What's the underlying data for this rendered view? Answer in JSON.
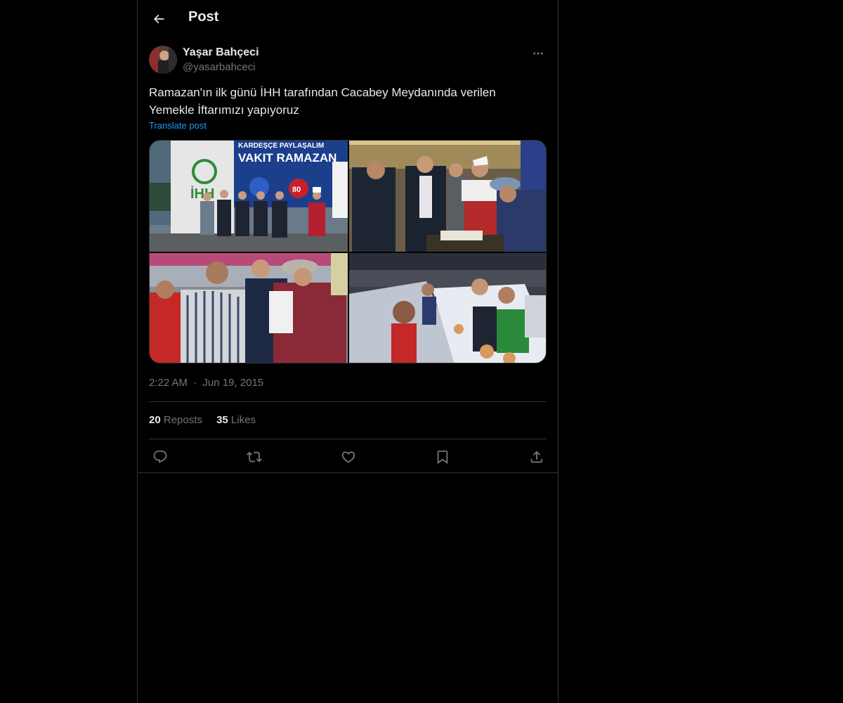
{
  "header": {
    "title": "Post"
  },
  "post": {
    "author": {
      "display_name": "Yaşar Bahçeci",
      "handle": "@yasarbahceci"
    },
    "text": "Ramazan'ın ilk günü İHH tarafından Cacabey Meydanında verilen\nYemekle İftarımızı yapıyoruz",
    "translate_label": "Translate post",
    "time": "2:22 AM",
    "separator": "·",
    "date": "Jun 19, 2015",
    "reposts_count": "20",
    "reposts_label": "Reposts",
    "likes_count": "35",
    "likes_label": "Likes"
  },
  "media": {
    "tile1_sign_top": "KARDEŞÇE PAYLAŞALIM",
    "tile1_sign_main": "VAKIT RAMAZAN",
    "tile1_logo": "İHH",
    "tile1_badge": "80"
  },
  "icons": {
    "back": "arrow-left-icon",
    "more": "more-horizontal-icon",
    "reply": "reply-icon",
    "repost": "repost-icon",
    "like": "heart-icon",
    "bookmark": "bookmark-icon",
    "share": "share-icon"
  },
  "colors": {
    "background": "#000000",
    "text_primary": "#e7e9ea",
    "text_secondary": "#71767b",
    "link": "#1d9bf0",
    "border": "#2f3336"
  }
}
